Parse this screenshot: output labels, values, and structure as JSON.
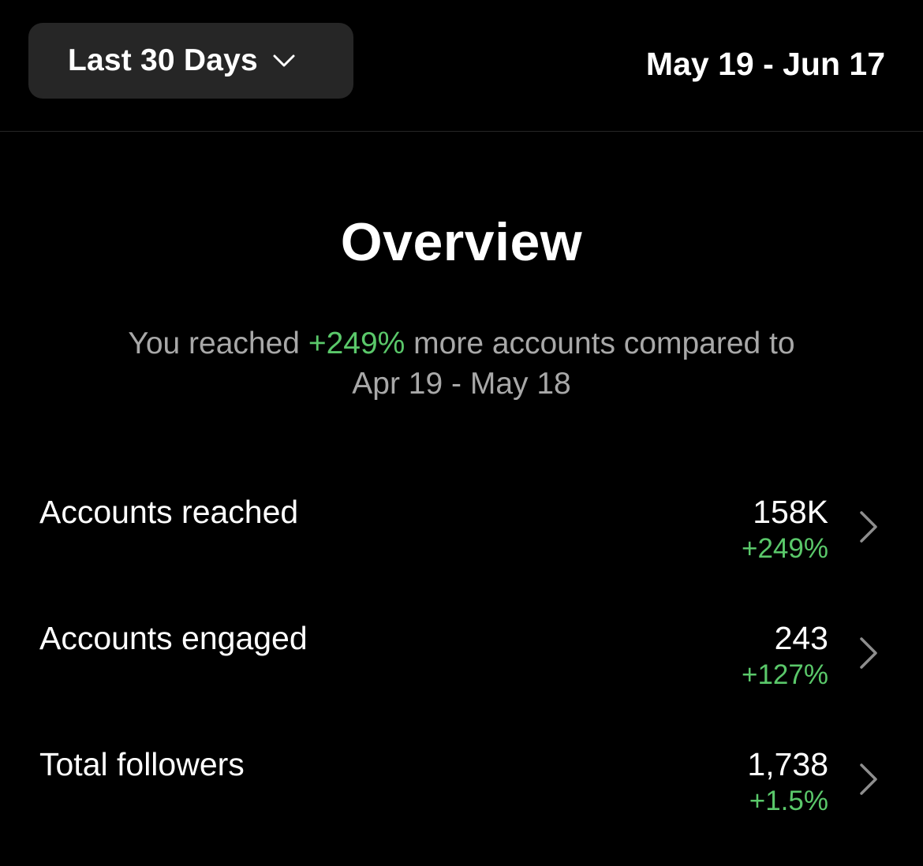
{
  "header": {
    "range_label": "Last 30 Days",
    "date_range": "May 19 - Jun 17"
  },
  "overview": {
    "title": "Overview",
    "summary_prefix": "You reached ",
    "summary_highlight": "+249%",
    "summary_suffix": " more accounts compared to",
    "summary_comparison": "Apr 19 - May 18"
  },
  "metrics": [
    {
      "label": "Accounts reached",
      "value": "158K",
      "change": "+249%"
    },
    {
      "label": "Accounts engaged",
      "value": "243",
      "change": "+127%"
    },
    {
      "label": "Total followers",
      "value": "1,738",
      "change": "+1.5%"
    }
  ],
  "colors": {
    "background": "#000000",
    "button_bg": "#262626",
    "positive": "#5ac86a",
    "muted_text": "#a8a8a8",
    "chevron": "#8e8e8e"
  },
  "icons": {
    "range_dropdown": "chevron-down-icon",
    "metric_disclosure": "chevron-right-icon"
  }
}
